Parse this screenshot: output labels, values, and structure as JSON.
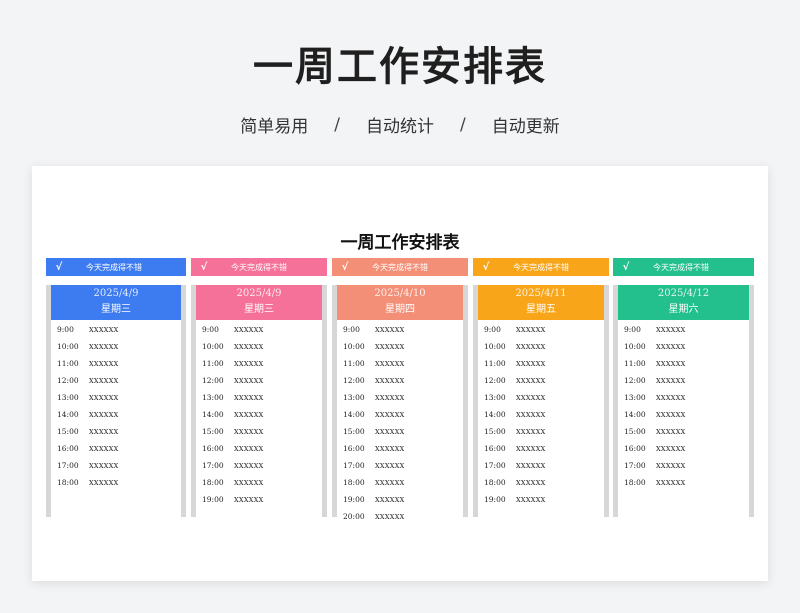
{
  "header": {
    "title": "一周工作安排表",
    "features": [
      "简单易用",
      "自动统计",
      "自动更新"
    ],
    "separator": "/"
  },
  "sheet": {
    "title": "一周工作安排表"
  },
  "columns": [
    {
      "color": "#3c7bf0",
      "status": {
        "check": "√",
        "text": "今天完成得不错"
      },
      "date": "2025/4/9",
      "weekday": "星期三",
      "slots": [
        {
          "time": "9:00",
          "task": "XXXXXX"
        },
        {
          "time": "10:00",
          "task": "XXXXXX"
        },
        {
          "time": "11:00",
          "task": "XXXXXX"
        },
        {
          "time": "12:00",
          "task": "XXXXXX"
        },
        {
          "time": "13:00",
          "task": "XXXXXX"
        },
        {
          "time": "14:00",
          "task": "XXXXXX"
        },
        {
          "time": "15:00",
          "task": "XXXXXX"
        },
        {
          "time": "16:00",
          "task": "XXXXXX"
        },
        {
          "time": "17:00",
          "task": "XXXXXX"
        },
        {
          "time": "18:00",
          "task": "XXXXXX"
        }
      ]
    },
    {
      "color": "#f57199",
      "status": {
        "check": "√",
        "text": "今天完成得不错"
      },
      "date": "2025/4/9",
      "weekday": "星期三",
      "slots": [
        {
          "time": "9:00",
          "task": "XXXXXX"
        },
        {
          "time": "10:00",
          "task": "XXXXXX"
        },
        {
          "time": "11:00",
          "task": "XXXXXX"
        },
        {
          "time": "12:00",
          "task": "XXXXXX"
        },
        {
          "time": "13:00",
          "task": "XXXXXX"
        },
        {
          "time": "14:00",
          "task": "XXXXXX"
        },
        {
          "time": "15:00",
          "task": "XXXXXX"
        },
        {
          "time": "16:00",
          "task": "XXXXXX"
        },
        {
          "time": "17:00",
          "task": "XXXXXX"
        },
        {
          "time": "18:00",
          "task": "XXXXXX"
        },
        {
          "time": "19:00",
          "task": "XXXXXX"
        }
      ]
    },
    {
      "color": "#f48f77",
      "status": {
        "check": "√",
        "text": "今天完成得不错"
      },
      "date": "2025/4/10",
      "weekday": "星期四",
      "slots": [
        {
          "time": "9:00",
          "task": "XXXXXX"
        },
        {
          "time": "10:00",
          "task": "XXXXXX"
        },
        {
          "time": "11:00",
          "task": "XXXXXX"
        },
        {
          "time": "12:00",
          "task": "XXXXXX"
        },
        {
          "time": "13:00",
          "task": "XXXXXX"
        },
        {
          "time": "14:00",
          "task": "XXXXXX"
        },
        {
          "time": "15:00",
          "task": "XXXXXX"
        },
        {
          "time": "16:00",
          "task": "XXXXXX"
        },
        {
          "time": "17:00",
          "task": "XXXXXX"
        },
        {
          "time": "18:00",
          "task": "XXXXXX"
        },
        {
          "time": "19:00",
          "task": "XXXXXX"
        },
        {
          "time": "20:00",
          "task": "XXXXXX"
        }
      ]
    },
    {
      "color": "#f8a51a",
      "status": {
        "check": "√",
        "text": "今天完成得不错"
      },
      "date": "2025/4/11",
      "weekday": "星期五",
      "slots": [
        {
          "time": "9:00",
          "task": "XXXXXX"
        },
        {
          "time": "10:00",
          "task": "XXXXXX"
        },
        {
          "time": "11:00",
          "task": "XXXXXX"
        },
        {
          "time": "12:00",
          "task": "XXXXXX"
        },
        {
          "time": "13:00",
          "task": "XXXXXX"
        },
        {
          "time": "14:00",
          "task": "XXXXXX"
        },
        {
          "time": "15:00",
          "task": "XXXXXX"
        },
        {
          "time": "16:00",
          "task": "XXXXXX"
        },
        {
          "time": "17:00",
          "task": "XXXXXX"
        },
        {
          "time": "18:00",
          "task": "XXXXXX"
        },
        {
          "time": "19:00",
          "task": "XXXXXX"
        }
      ]
    },
    {
      "color": "#23bf8c",
      "status": {
        "check": "√",
        "text": "今天完成得不错"
      },
      "date": "2025/4/12",
      "weekday": "星期六",
      "slots": [
        {
          "time": "9:00",
          "task": "XXXXXX"
        },
        {
          "time": "10:00",
          "task": "XXXXXX"
        },
        {
          "time": "11:00",
          "task": "XXXXXX"
        },
        {
          "time": "12:00",
          "task": "XXXXXX"
        },
        {
          "time": "13:00",
          "task": "XXXXXX"
        },
        {
          "time": "14:00",
          "task": "XXXXXX"
        },
        {
          "time": "15:00",
          "task": "XXXXXX"
        },
        {
          "time": "16:00",
          "task": "XXXXXX"
        },
        {
          "time": "17:00",
          "task": "XXXXXX"
        },
        {
          "time": "18:00",
          "task": "XXXXXX"
        }
      ]
    }
  ]
}
